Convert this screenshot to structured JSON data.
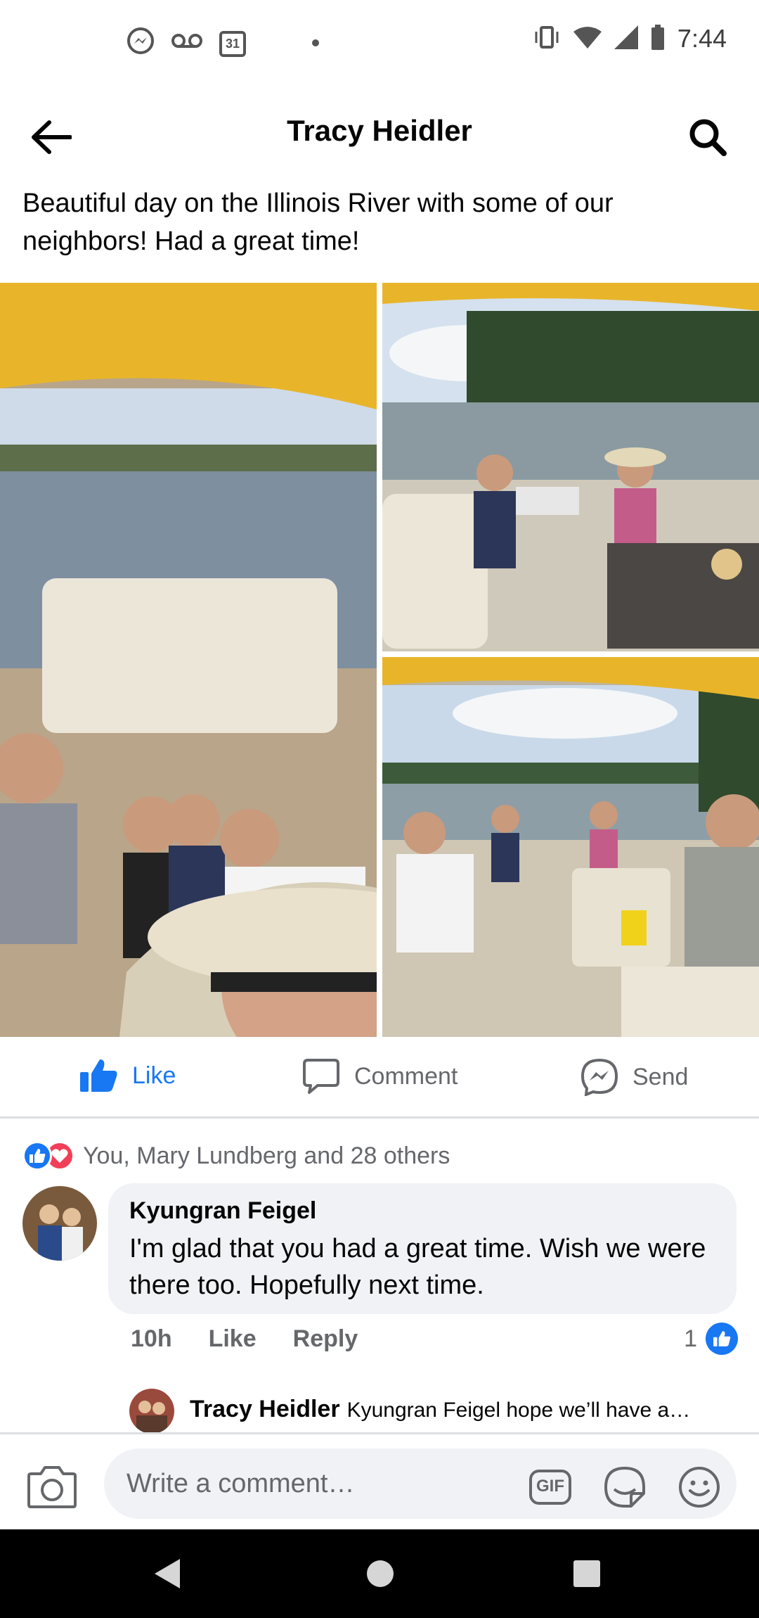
{
  "status_bar": {
    "time": "7:44",
    "calendar_day": "31",
    "icons": [
      "messenger-icon",
      "voicemail-icon",
      "calendar-icon",
      "vibrate-icon",
      "wifi-icon",
      "signal-icon",
      "battery-icon"
    ]
  },
  "header": {
    "title": "Tracy Heidler"
  },
  "post": {
    "caption": "Beautiful day on the Illinois River with some of our neighbors! Had a great time!",
    "photos": [
      "group selfie on pontoon boat",
      "two women seated on boat",
      "friends seated on boat deck"
    ]
  },
  "actions": {
    "like": "Like",
    "comment": "Comment",
    "send": "Send"
  },
  "reactions": {
    "summary": "You, Mary Lundberg and 28 others"
  },
  "comment": {
    "author": "Kyungran Feigel",
    "text": "I'm glad that you had a great time. Wish we were there too.  Hopefully next time.",
    "time": "10h",
    "like": "Like",
    "reply": "Reply",
    "like_count": "1"
  },
  "reply_preview": {
    "author": "Tracy Heidler",
    "text": "Kyungran Feigel hope we’ll have a…"
  },
  "composer": {
    "placeholder": "Write a comment…",
    "gif_label": "GIF"
  },
  "colors": {
    "accent": "#1877f2",
    "love": "#f33e58",
    "secondary_text": "#65676b",
    "bubble": "#f0f2f5"
  }
}
